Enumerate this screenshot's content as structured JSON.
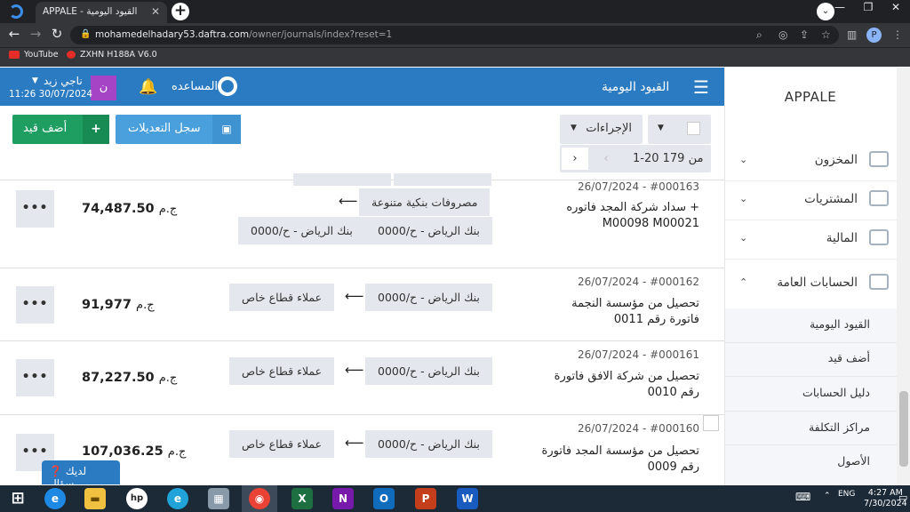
{
  "browser": {
    "tab_title": "APPALE - القيود اليومية",
    "tab_close": "✕",
    "new_tab": "+",
    "tab_list": "⌄",
    "url_host": "mohamedelhadary53.daftra.com",
    "url_path": "/owner/journals/index?reset=1",
    "profile_initial": "P",
    "window_controls": [
      "—",
      "❐",
      "✕"
    ],
    "bookmarks": [
      "YouTube",
      "ZXHN H188A V6.0"
    ]
  },
  "header": {
    "menu_icon": "☰",
    "title": "القيود اليومية",
    "help_label": "المساعده",
    "bell_icon": "🔔",
    "avatar_initial": "ن",
    "user_name": "ناجي زيد",
    "user_caret": "▼",
    "user_datetime": "11:26 30/07/2024"
  },
  "brand": "APPALE",
  "toolbar": {
    "add_label": "أضف قيد",
    "add_icon": "+",
    "log_label": "سجل التعديلات",
    "log_icon": "▣",
    "actions_label": "الإجراءات",
    "caret": "▼",
    "pager_next": "›",
    "pager_prev": "‹",
    "pager_text": "1-20  من 179"
  },
  "journals": [
    {
      "head": "26/07/2024 - #000163",
      "desc": "سداد شركة المجد فاتوره + M00098 M00021",
      "debit": [
        "مصروفات بنكية متنوعة"
      ],
      "credit": [
        "بنك الرياض - ح/0000",
        "بنك الرياض - ح/0000"
      ],
      "amount": "74,487.50",
      "currency": "ج.م",
      "more": "•••"
    },
    {
      "head": "26/07/2024 - #000162",
      "desc": "تحصيل من مؤسسة النجمة فاتورة رقم 0011",
      "debit": [
        "بنك الرياض - ح/0000"
      ],
      "credit": [
        "عملاء قطاع خاص"
      ],
      "amount": "91,977",
      "currency": "ج.م",
      "more": "•••"
    },
    {
      "head": "26/07/2024 - #000161",
      "desc": "تحصيل من شركة الافق فاتورة رقم 0010",
      "debit": [
        "بنك الرياض - ح/0000"
      ],
      "credit": [
        "عملاء قطاع خاص"
      ],
      "amount": "87,227.50",
      "currency": "ج.م",
      "more": "•••"
    },
    {
      "head": "26/07/2024 - #000160",
      "desc": "تحصيل من مؤسسة المجد فاتورة رقم 0009",
      "debit": [
        "بنك الرياض - ح/0000"
      ],
      "credit": [
        "عملاء قطاع خاص"
      ],
      "amount": "107,036.25",
      "currency": "ج.م",
      "more": "•••"
    }
  ],
  "arrow": "⟵",
  "sidebar": {
    "items": [
      {
        "label": "المخزون",
        "chev": "⌄"
      },
      {
        "label": "المشتريات",
        "chev": "⌄"
      },
      {
        "label": "المالية",
        "chev": "⌄"
      },
      {
        "label": "الحسابات العامة",
        "chev": "⌃"
      }
    ],
    "submenu": [
      "القيود اليومية",
      "أضف قيد",
      "دليل الحسابات",
      "مراكز التكلفة",
      "الأصول"
    ]
  },
  "question_label": "لديك سؤال",
  "taskbar": {
    "lang": "ENG",
    "time": "4:27 AM",
    "date": "7/30/2024"
  }
}
